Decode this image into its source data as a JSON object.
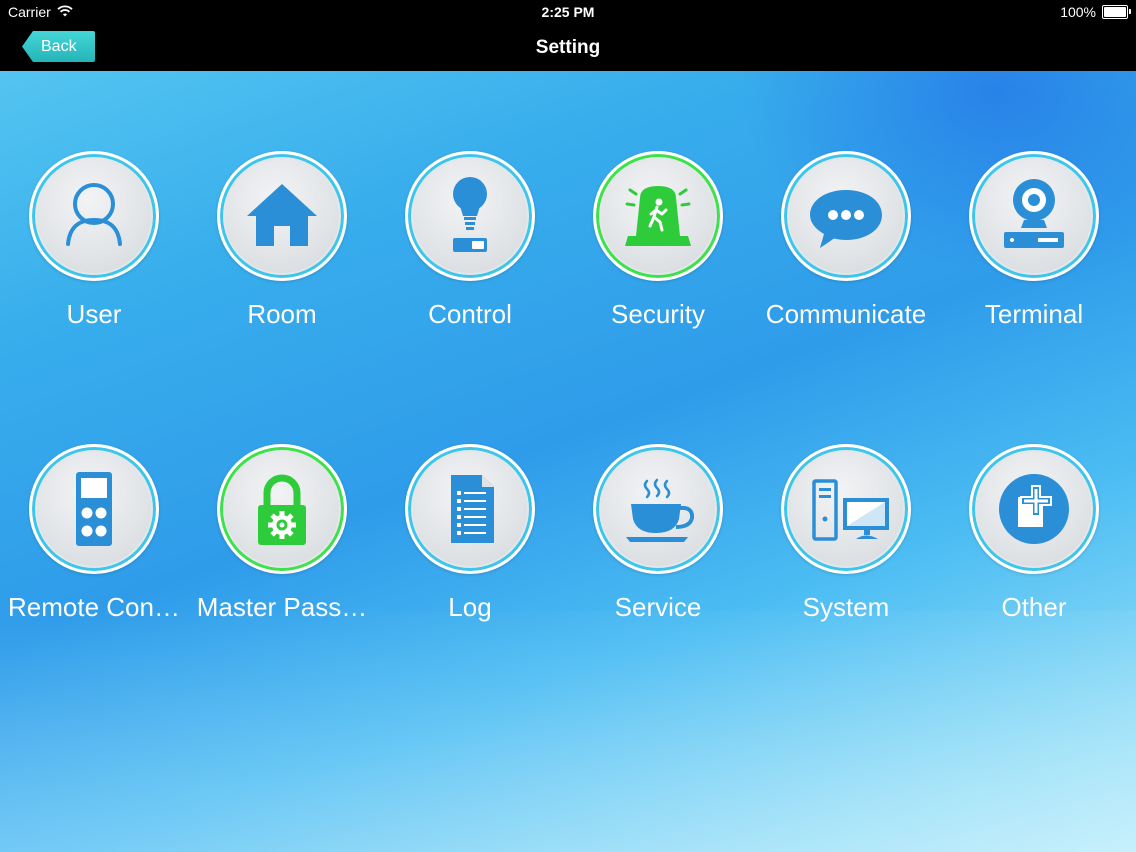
{
  "status_bar": {
    "carrier": "Carrier",
    "time": "2:25 PM",
    "battery_text": "100%",
    "battery_level": 1.0
  },
  "nav": {
    "back_label": "Back",
    "title": "Setting"
  },
  "colors": {
    "accent_teal": "#30c6c9",
    "icon_blue": "#2a8fd6",
    "icon_green": "#2ecc3a",
    "ring_blue": "#3cc6ec",
    "ring_green": "#3be24a"
  },
  "tiles": [
    {
      "label": "User",
      "icon": "user-icon"
    },
    {
      "label": "Room",
      "icon": "house-icon"
    },
    {
      "label": "Control",
      "icon": "lightbulb-switch-icon"
    },
    {
      "label": "Security",
      "icon": "alarm-siren-icon"
    },
    {
      "label": "Communicate",
      "icon": "chat-bubble-icon"
    },
    {
      "label": "Terminal",
      "icon": "camera-dvr-icon"
    },
    {
      "label": "Remote Con…",
      "icon": "remote-control-icon"
    },
    {
      "label": "Master Pass…",
      "icon": "padlock-gear-icon"
    },
    {
      "label": "Log",
      "icon": "document-list-icon"
    },
    {
      "label": "Service",
      "icon": "coffee-cup-icon"
    },
    {
      "label": "System",
      "icon": "desktop-computer-icon"
    },
    {
      "label": "Other",
      "icon": "plus-card-icon"
    }
  ]
}
